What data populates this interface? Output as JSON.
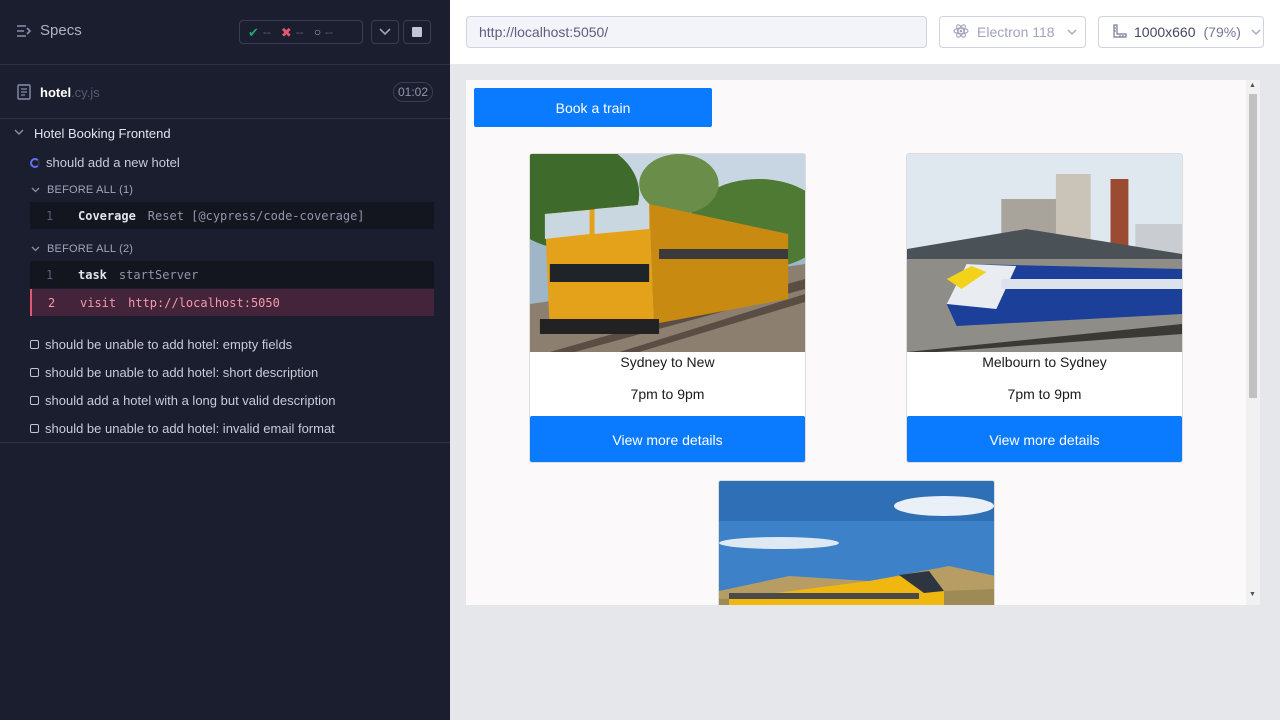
{
  "reporter": {
    "specs_label": "Specs",
    "stats": {
      "passed": "--",
      "failed": "--",
      "pending": "--"
    },
    "file": {
      "name": "hotel",
      "ext": ".cy.js",
      "duration": "01:02"
    },
    "suite_title": "Hotel Booking Frontend",
    "running_test": "should add a new hotel",
    "hooks": [
      {
        "title": "BEFORE ALL (1)",
        "commands": [
          {
            "num": "1",
            "name": "Coverage",
            "message": "Reset [@cypress/code-coverage]"
          }
        ]
      },
      {
        "title": "BEFORE ALL (2)",
        "commands": [
          {
            "num": "1",
            "name": "task",
            "message": "startServer"
          },
          {
            "num": "2",
            "name": "visit",
            "message": "http://localhost:5050"
          }
        ]
      }
    ],
    "pending_tests": [
      "should be unable to add hotel: empty fields",
      "should be unable to add hotel: short description",
      "should add a hotel with a long but valid description",
      "should be unable to add hotel: invalid email format"
    ]
  },
  "toolbar": {
    "url": "http://localhost:5050/",
    "browser": "Electron 118",
    "viewport": "1000x660",
    "scale": "(79%)"
  },
  "app": {
    "book_button": "Book a train",
    "cards": [
      {
        "title": "Sydney to New",
        "time": "7pm to 9pm",
        "button": "View more details"
      },
      {
        "title": "Melbourn to Sydney",
        "time": "7pm to 9pm",
        "button": "View more details"
      }
    ]
  },
  "colors": {
    "accent": "#0a7bff",
    "reporter_bg": "#1b1e2e",
    "failed": "#e45770",
    "passed": "#1fa971"
  }
}
